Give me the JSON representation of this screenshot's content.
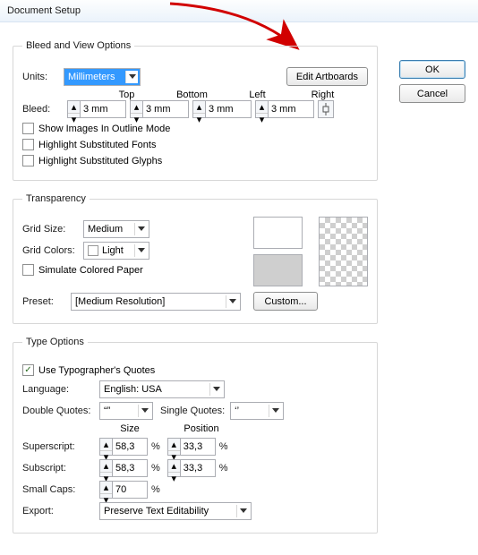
{
  "title": "Document Setup",
  "buttons": {
    "editArtboards": "Edit Artboards",
    "ok": "OK",
    "cancel": "Cancel",
    "custom": "Custom..."
  },
  "bleed": {
    "legend": "Bleed and View Options",
    "unitsLabel": "Units:",
    "units": "Millimeters",
    "headers": [
      "Top",
      "Bottom",
      "Left",
      "Right"
    ],
    "bleedLabel": "Bleed:",
    "top": "3 mm",
    "bottom": "3 mm",
    "left": "3 mm",
    "right": "3 mm",
    "cb1": "Show Images In Outline Mode",
    "cb2": "Highlight Substituted Fonts",
    "cb3": "Highlight Substituted Glyphs"
  },
  "trans": {
    "legend": "Transparency",
    "gridSizeLabel": "Grid Size:",
    "gridSize": "Medium",
    "gridColorsLabel": "Grid Colors:",
    "gridColors": "Light",
    "cb": "Simulate Colored Paper",
    "presetLabel": "Preset:",
    "preset": "[Medium Resolution]",
    "swatch1": "#ffffff",
    "swatch2": "#cfcfcf"
  },
  "type": {
    "legend": "Type Options",
    "cb": "Use Typographer's Quotes",
    "langLabel": "Language:",
    "lang": "English: USA",
    "dqLabel": "Double Quotes:",
    "dq": "“”",
    "sqLabel": "Single Quotes:",
    "sq": "‘’",
    "sizeHdr": "Size",
    "posHdr": "Position",
    "supLabel": "Superscript:",
    "supSize": "58,3",
    "supPos": "33,3",
    "subLabel": "Subscript:",
    "subSize": "58,3",
    "subPos": "33,3",
    "scLabel": "Small Caps:",
    "sc": "70",
    "pct": "%",
    "exportLabel": "Export:",
    "export": "Preserve Text Editability"
  }
}
